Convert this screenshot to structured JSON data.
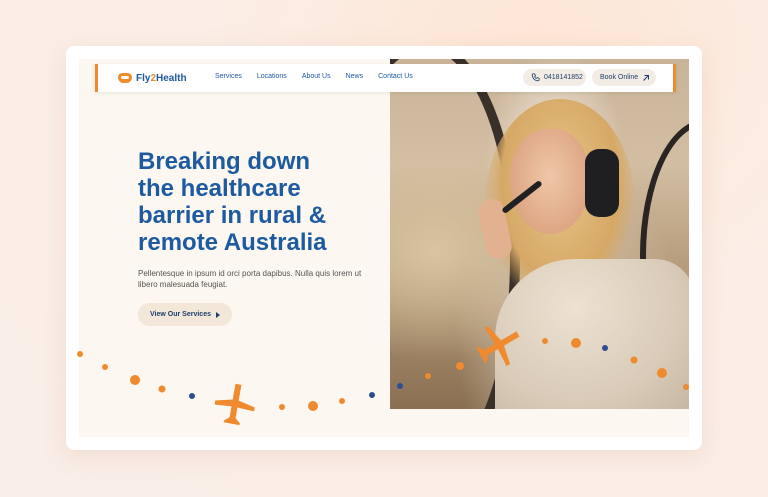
{
  "brand": {
    "part1": "Fly",
    "part2": "2",
    "part3": "Health"
  },
  "nav": {
    "links": [
      "Services",
      "Locations",
      "About Us",
      "News",
      "Contact Us"
    ],
    "phone": "0418141852",
    "book": "Book Online"
  },
  "hero": {
    "title_lines": [
      "Breaking down",
      "the healthcare",
      "barrier in rural &",
      "remote Australia"
    ],
    "subtitle": "Pellentesque in ipsum id orci porta dapibus. Nulla quis lorem ut libero malesuada feugiat.",
    "cta": "View Our Services"
  },
  "colors": {
    "brand_blue": "#1e5aa0",
    "accent_orange": "#f08a2e",
    "dot_blue": "#2a4f8f"
  },
  "icons": [
    "logo-mark-icon",
    "phone-icon",
    "arrow-up-right-icon",
    "play-triangle-icon",
    "airplane-icon"
  ]
}
